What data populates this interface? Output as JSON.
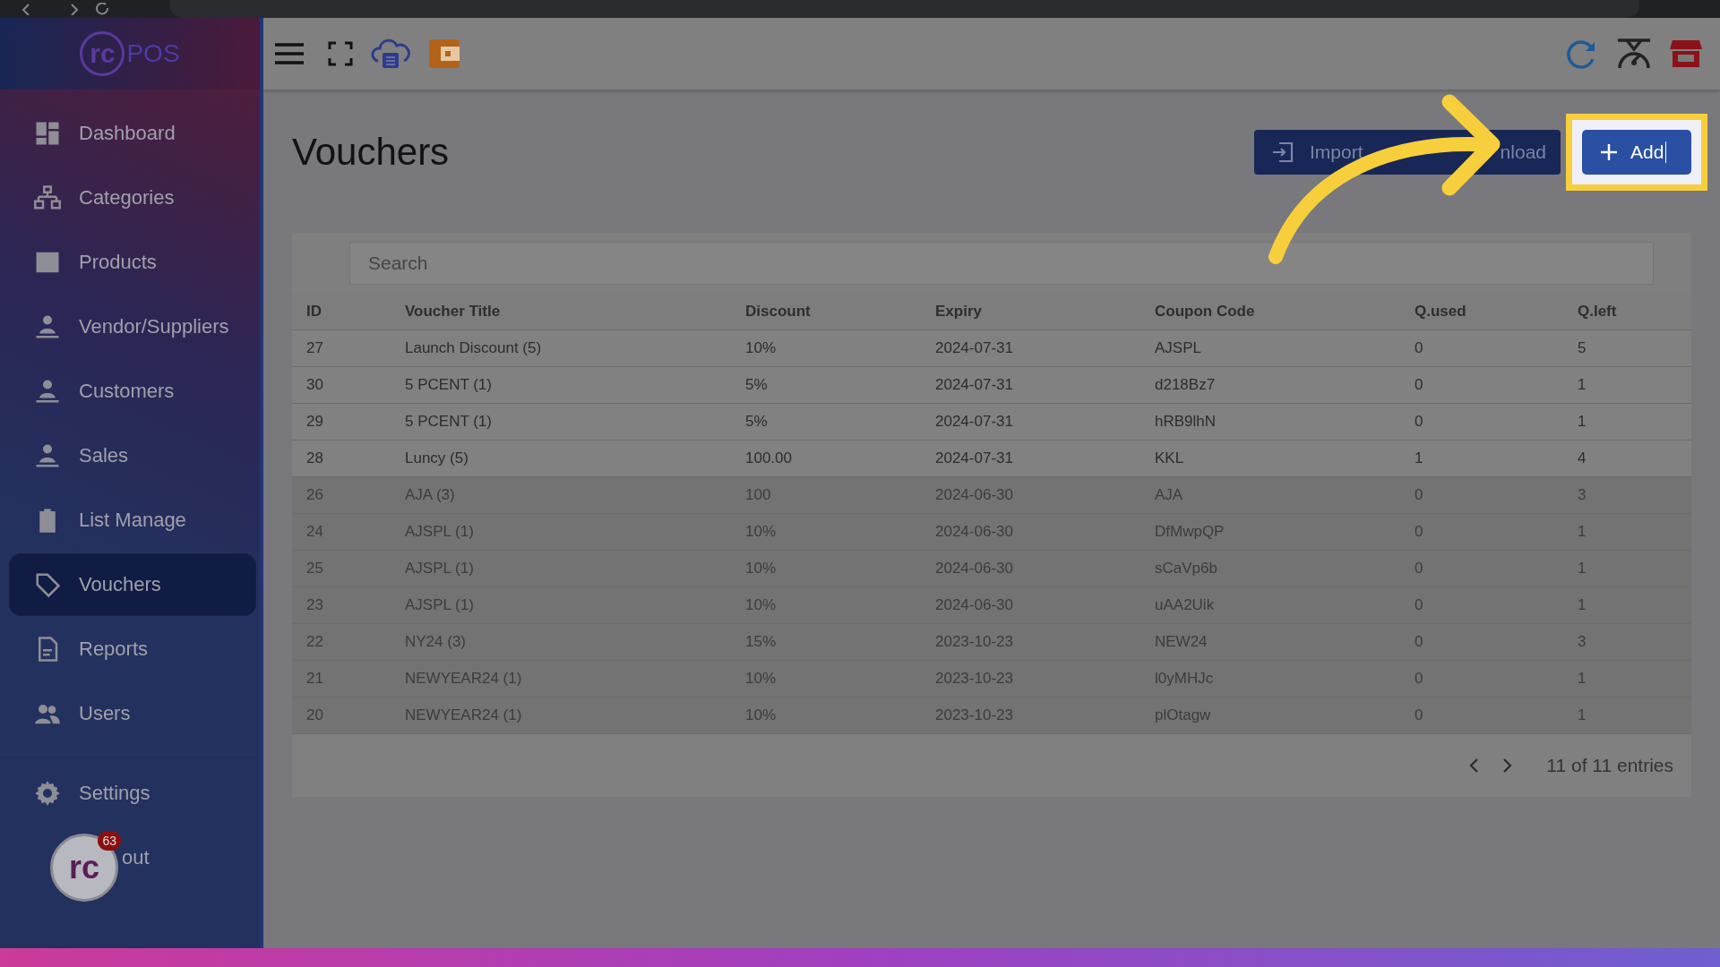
{
  "sidebar": {
    "logo": {
      "mark": "rc",
      "text": "POS"
    },
    "items": [
      {
        "label": "Dashboard",
        "selected": false
      },
      {
        "label": "Categories",
        "selected": false
      },
      {
        "label": "Products",
        "selected": false
      },
      {
        "label": "Vendor/Suppliers",
        "selected": false
      },
      {
        "label": "Customers",
        "selected": false
      },
      {
        "label": "Sales",
        "selected": false
      },
      {
        "label": "List Manage",
        "selected": false
      },
      {
        "label": "Vouchers",
        "selected": true
      },
      {
        "label": "Reports",
        "selected": false
      },
      {
        "label": "Users",
        "selected": false
      }
    ],
    "bottom_items": [
      {
        "label": "Settings"
      },
      {
        "label": "out"
      }
    ],
    "chat_widget": {
      "mark": "rc",
      "badge": "63"
    }
  },
  "page": {
    "title": "Vouchers",
    "actions": [
      {
        "label": "Import",
        "kind": "import"
      },
      {
        "label": "nload",
        "kind": "download"
      },
      {
        "label": "Add",
        "kind": "add"
      }
    ]
  },
  "table": {
    "search": {
      "placeholder": "Search"
    },
    "columns": [
      "ID",
      "Voucher Title",
      "Discount",
      "Expiry",
      "Coupon Code",
      "Q.used",
      "Q.left"
    ],
    "rows": [
      {
        "cells": [
          "27",
          "Launch Discount (5)",
          "10%",
          "2024-07-31",
          "AJSPL",
          "0",
          "5"
        ],
        "expired": false
      },
      {
        "cells": [
          "30",
          "5 PCENT (1)",
          "5%",
          "2024-07-31",
          "d218Bz7",
          "0",
          "1"
        ],
        "expired": false
      },
      {
        "cells": [
          "29",
          "5 PCENT (1)",
          "5%",
          "2024-07-31",
          "hRB9lhN",
          "0",
          "1"
        ],
        "expired": false
      },
      {
        "cells": [
          "28",
          "Luncy (5)",
          "100.00",
          "2024-07-31",
          "KKL",
          "1",
          "4"
        ],
        "expired": false
      },
      {
        "cells": [
          "26",
          "AJA (3)",
          "100",
          "2024-06-30",
          "AJA",
          "0",
          "3"
        ],
        "expired": true
      },
      {
        "cells": [
          "24",
          "AJSPL (1)",
          "10%",
          "2024-06-30",
          "DfMwpQP",
          "0",
          "1"
        ],
        "expired": true
      },
      {
        "cells": [
          "25",
          "AJSPL (1)",
          "10%",
          "2024-06-30",
          "sCaVp6b",
          "0",
          "1"
        ],
        "expired": true
      },
      {
        "cells": [
          "23",
          "AJSPL (1)",
          "10%",
          "2024-06-30",
          "uAA2Uik",
          "0",
          "1"
        ],
        "expired": true
      },
      {
        "cells": [
          "22",
          "NY24 (3)",
          "15%",
          "2023-10-23",
          "NEW24",
          "0",
          "3"
        ],
        "expired": true
      },
      {
        "cells": [
          "21",
          "NEWYEAR24 (1)",
          "10%",
          "2023-10-23",
          "l0yMHJc",
          "0",
          "1"
        ],
        "expired": true
      },
      {
        "cells": [
          "20",
          "NEWYEAR24 (1)",
          "10%",
          "2023-10-23",
          "plOtagw",
          "0",
          "1"
        ],
        "expired": true
      }
    ],
    "pagination": {
      "summary": "11 of 11 entries"
    }
  }
}
